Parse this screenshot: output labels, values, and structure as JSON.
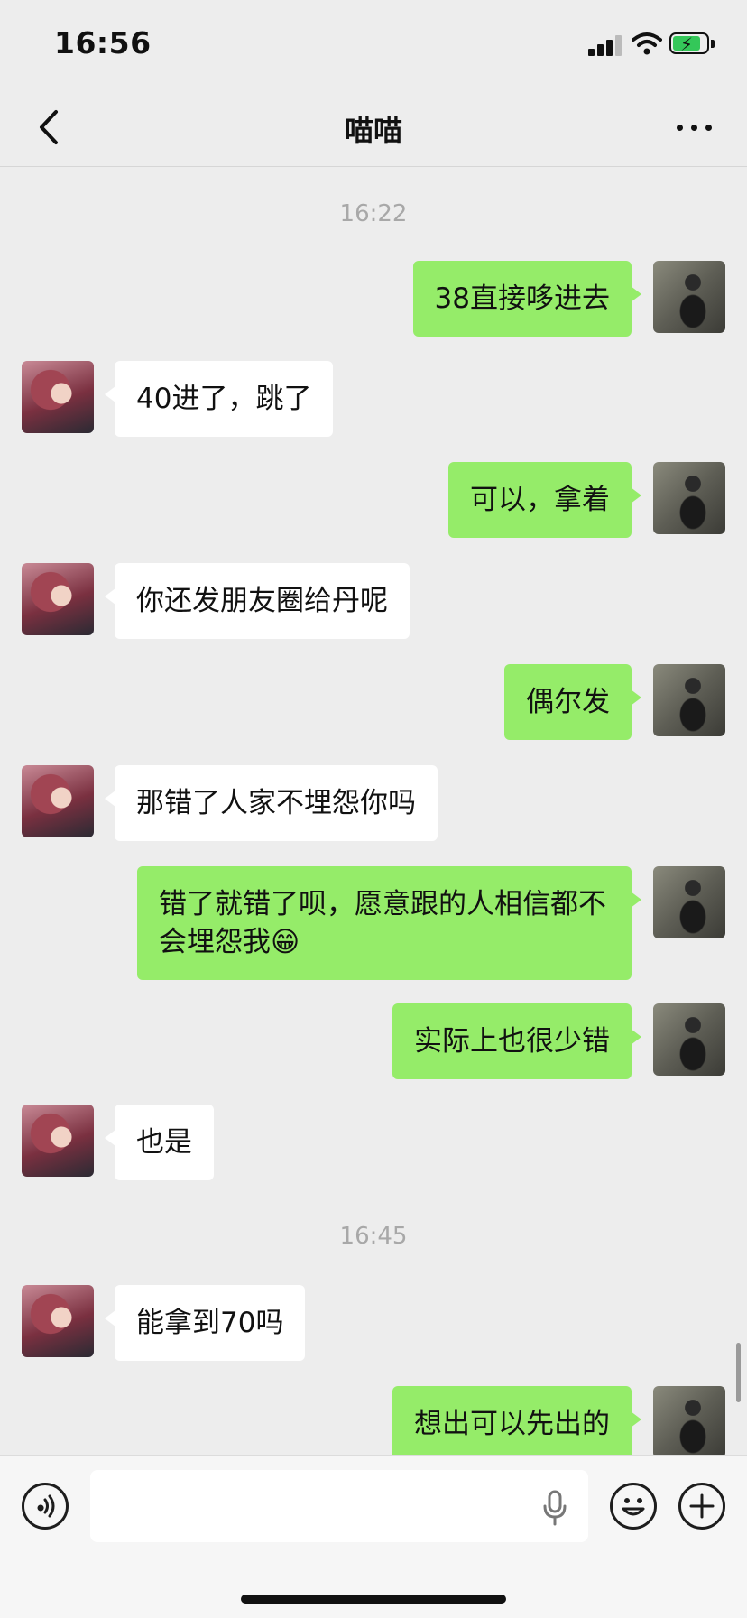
{
  "status_bar": {
    "time": "16:56"
  },
  "nav": {
    "title": "喵喵"
  },
  "messages": [
    {
      "type": "timestamp",
      "text": "16:22"
    },
    {
      "side": "self",
      "text": "38直接哆进去"
    },
    {
      "side": "other",
      "text": "40进了，跳了"
    },
    {
      "side": "self",
      "text": "可以，拿着"
    },
    {
      "side": "other",
      "text": "你还发朋友圈给丹呢"
    },
    {
      "side": "self",
      "text": "偶尔发"
    },
    {
      "side": "other",
      "text": "那错了人家不埋怨你吗"
    },
    {
      "side": "self",
      "text": "错了就错了呗，愿意跟的人相信都不会埋怨我😁"
    },
    {
      "side": "self",
      "text": "实际上也很少错"
    },
    {
      "side": "other",
      "text": "也是"
    },
    {
      "type": "timestamp",
      "text": "16:45"
    },
    {
      "side": "other",
      "text": "能拿到70吗"
    },
    {
      "side": "self",
      "text": "想出可以先出的"
    }
  ],
  "input_bar": {
    "voice_icon": "voice-icon",
    "mic_icon": "microphone-icon",
    "emoji_icon": "emoji-icon",
    "plus_icon": "plus-icon"
  },
  "colors": {
    "self_bubble": "#95ec69",
    "other_bubble": "#ffffff",
    "background": "#ededed"
  }
}
